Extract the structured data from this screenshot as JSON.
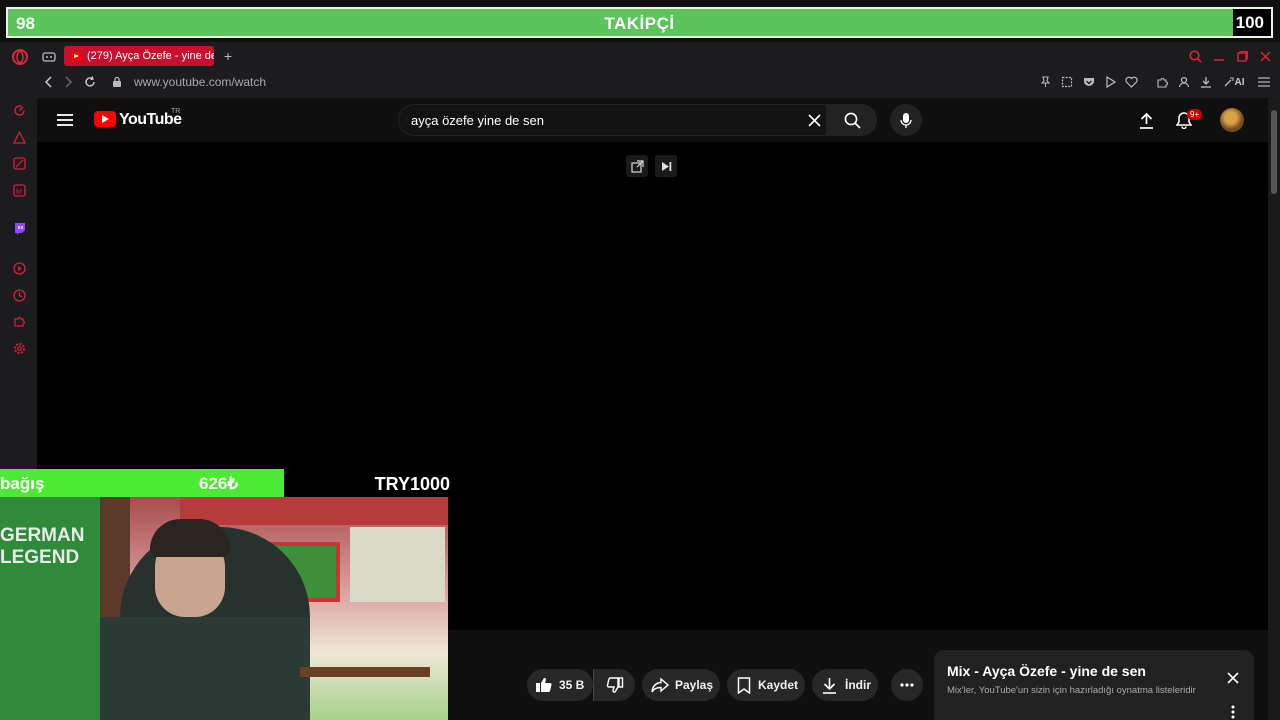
{
  "overlay": {
    "follower_current": "98",
    "follower_label": "TAKİPÇİ",
    "follower_goal": "100",
    "donation_label": "bağış",
    "donation_amount": "626₺",
    "donation_goal": "TRY1000",
    "donation_progress": 0.626
  },
  "webcam": {
    "shirt_text": "GERMAN\nLEGEND"
  },
  "browser": {
    "tab_title": "(279) Ayça Özefe - yine de",
    "url": "www.youtube.com/watch",
    "ai_label": "AI"
  },
  "youtube": {
    "logo_text": "YouTube",
    "region": "TR",
    "search_value": "ayça özefe yine de sen",
    "notification_badge": "9+"
  },
  "actions": {
    "like_count": "35 B",
    "share_label": "Paylaş",
    "save_label": "Kaydet",
    "download_label": "İndir"
  },
  "mix": {
    "title": "Mix - Ayça Özefe - yine de sen",
    "subtitle": "Mix'ler, YouTube'un sizin için hazırladığı oynatma listeleridir"
  },
  "colors": {
    "follower_bar": "#5cc45a",
    "donation_fill": "#4bea34",
    "tab_active": "#c8102e",
    "youtube_red": "#ff0000"
  }
}
